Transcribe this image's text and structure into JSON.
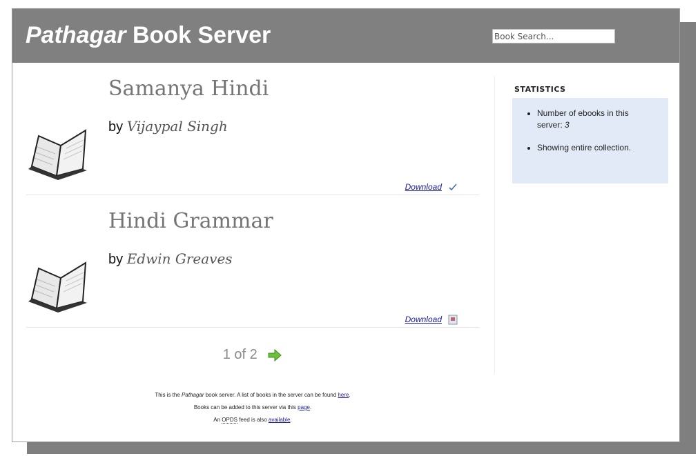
{
  "header": {
    "title_italic": "Pathagar",
    "title_rest": " Book Server",
    "search_placeholder": "Book Search..."
  },
  "books": [
    {
      "title": "Samanya Hindi",
      "by_label": "by",
      "author": "Vijaypal Singh",
      "download_label": "Download",
      "status_icon": "checkmark-icon"
    },
    {
      "title": "Hindi Grammar",
      "by_label": "by",
      "author": "Edwin Greaves",
      "download_label": "Download",
      "status_icon": "document-icon"
    }
  ],
  "pager": {
    "text": "1 of 2",
    "next_icon": "arrow-right-icon"
  },
  "sidebar": {
    "heading": "STATISTICS",
    "count_label": "Number of ebooks in this server: ",
    "count_value": "3",
    "collection_text": "Showing entire collection."
  },
  "footer": {
    "line1_a": "This is the ",
    "line1_b": "Pathagar",
    "line1_c": " book server. A list of books in the server can be found ",
    "line1_link": "here",
    "line1_d": ".",
    "line2_a": "Books can be added to this server via this ",
    "line2_link": "page",
    "line2_b": ".",
    "line3_a": "An ",
    "line3_abbr": "OPDS",
    "line3_b": " feed is also ",
    "line3_link": "available",
    "line3_c": "."
  },
  "colors": {
    "header_bg": "#808080",
    "sidebar_box_bg": "#e3eaf7",
    "link": "#1a1aa6",
    "accent_green": "#5fb82a"
  }
}
